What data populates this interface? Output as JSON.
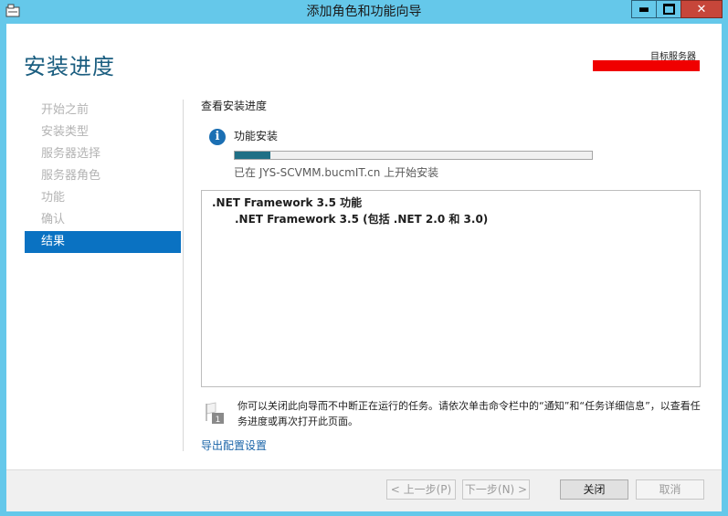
{
  "window": {
    "title": "添加角色和功能向导"
  },
  "header": {
    "title": "安装进度",
    "target_label": "目标服务器"
  },
  "nav": {
    "items": [
      {
        "label": "开始之前"
      },
      {
        "label": "安装类型"
      },
      {
        "label": "服务器选择"
      },
      {
        "label": "服务器角色"
      },
      {
        "label": "功能"
      },
      {
        "label": "确认"
      },
      {
        "label": "结果"
      }
    ],
    "active_index": 6
  },
  "main": {
    "section_title": "查看安装进度",
    "feature_label": "功能安装",
    "progress_fraction": 0.1,
    "status_text": "已在 JYS-SCVMM.bucmIT.cn 上开始安装",
    "results": {
      "line1": ".NET Framework 3.5 功能",
      "line2": ".NET Framework 3.5 (包括 .NET 2.0 和 3.0)"
    },
    "notice": "你可以关闭此向导而不中断正在运行的任务。请依次单击命令栏中的“通知”和“任务详细信息”，以查看任务进度或再次打开此页面。",
    "export_link": "导出配置设置"
  },
  "footer": {
    "prev_label": "< 上一步(P)",
    "next_label": "下一步(N) >",
    "close_label": "关闭",
    "cancel_label": "取消"
  },
  "colors": {
    "accent": "#0a72c2",
    "titlebar": "#65c8ea",
    "progress": "#1f6f85",
    "close_button": "#c7463a"
  }
}
